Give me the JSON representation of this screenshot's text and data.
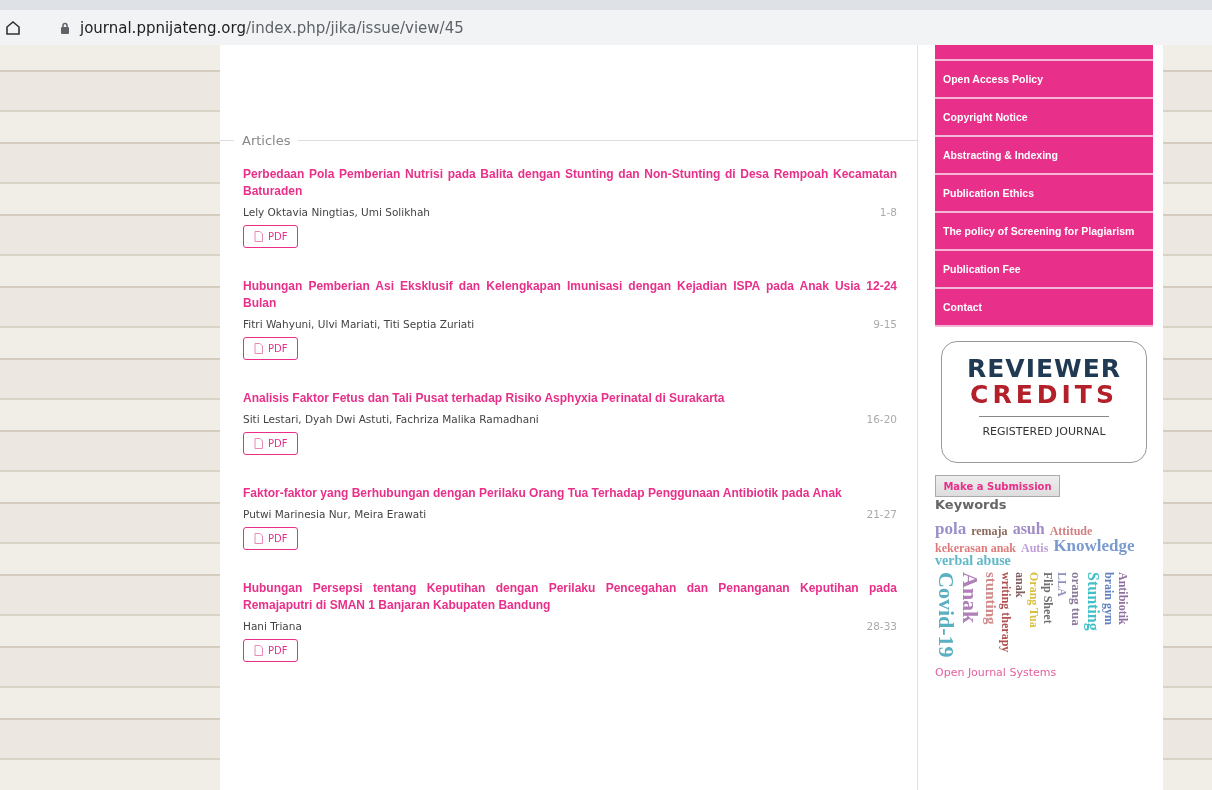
{
  "browser": {
    "url_host": "journal.ppnijateng.org",
    "url_path": "/index.php/jika/issue/view/45"
  },
  "articles_heading": "Articles",
  "articles": [
    {
      "title": "Perbedaan Pola Pemberian Nutrisi pada Balita dengan Stunting dan Non-Stunting di Desa Rempoah Kecamatan Baturaden",
      "authors": "Lely Oktavia Ningtias, Umi Solikhah",
      "pages": "1-8",
      "galley": "PDF"
    },
    {
      "title": "Hubungan Pemberian Asi Eksklusif dan Kelengkapan Imunisasi dengan Kejadian ISPA pada Anak Usia 12-24 Bulan",
      "authors": "Fitri Wahyuni, Ulvi Mariati, Titi Septia Zuriati",
      "pages": "9-15",
      "galley": "PDF"
    },
    {
      "title": "Analisis Faktor Fetus dan Tali Pusat terhadap Risiko Asphyxia Perinatal di Surakarta",
      "authors": "Siti Lestari, Dyah Dwi Astuti, Fachriza Malika Ramadhani",
      "pages": "16-20",
      "galley": "PDF"
    },
    {
      "title": "Faktor-faktor yang Berhubungan dengan Perilaku Orang Tua Terhadap Penggunaan Antibiotik pada Anak",
      "authors": "Putwi Marinesia Nur, Meira Erawati",
      "pages": "21-27",
      "galley": "PDF"
    },
    {
      "title": "Hubungan Persepsi tentang Keputihan dengan Perilaku Pencegahan dan Penanganan Keputihan pada Remajaputri di SMAN 1 Banjaran Kabupaten Bandung",
      "authors": "Hani Triana",
      "pages": "28-33",
      "galley": "PDF"
    }
  ],
  "sidebar": {
    "menu": [
      "Open Access Policy",
      "Copyright Notice",
      "Abstracting & Indexing",
      "Publication Ethics",
      "The policy of Screening for Plagiarism",
      "Publication Fee",
      "Contact"
    ],
    "badge": {
      "line1": "REVIEWER",
      "line2": "CREDITS",
      "line3": "REGISTERED JOURNAL"
    },
    "submit_button": "Make a Submission",
    "keywords_heading": "Keywords",
    "keywords": [
      {
        "text": "pola",
        "color": "#9a8fc8"
      },
      {
        "text": "remaja",
        "color": "#8a6a5a"
      },
      {
        "text": "asuh",
        "color": "#a08ac8"
      },
      {
        "text": "Attitude",
        "color": "#d08080"
      },
      {
        "text": "kekerasan anak",
        "color": "#e07a7a"
      },
      {
        "text": "Autis",
        "color": "#c0a0d8"
      },
      {
        "text": "Knowledge",
        "color": "#7a9ad0"
      },
      {
        "text": "verbal abuse",
        "color": "#60b8c8"
      },
      {
        "text": "Covid-19",
        "color": "#5ab0c0"
      },
      {
        "text": "Anak",
        "color": "#b080b8"
      },
      {
        "text": "stunting",
        "color": "#d08888"
      },
      {
        "text": "writing therapy",
        "color": "#b05050"
      },
      {
        "text": "anak",
        "color": "#806060"
      },
      {
        "text": "Orang Tua",
        "color": "#d8c040"
      },
      {
        "text": "Flip Sheet",
        "color": "#707070"
      },
      {
        "text": "LLA",
        "color": "#9090c0"
      },
      {
        "text": "orang tua",
        "color": "#8a7a9a"
      },
      {
        "text": "Stunting",
        "color": "#40c0c8"
      },
      {
        "text": "brain gym",
        "color": "#6080c0"
      },
      {
        "text": "Antibiotik",
        "color": "#9070a0"
      }
    ],
    "footer_link": "Open Journal Systems"
  }
}
